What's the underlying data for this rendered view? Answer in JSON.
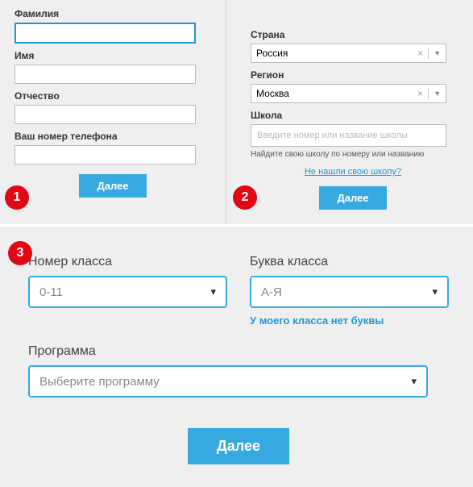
{
  "panel1": {
    "lastname_label": "Фамилия",
    "firstname_label": "Имя",
    "patronymic_label": "Отчество",
    "phone_label": "Ваш номер телефона",
    "next_btn": "Далее"
  },
  "panel2": {
    "country_label": "Страна",
    "country_value": "Россия",
    "region_label": "Регион",
    "region_value": "Москва",
    "school_label": "Школа",
    "school_placeholder": "Введите номер или название школы",
    "school_hint": "Найдите свою школу по номеру или названию",
    "noschool_link": "Не нашли свою школу?",
    "next_btn": "Далее"
  },
  "panel3": {
    "classnum_label": "Номер класса",
    "classnum_value": "0-11",
    "classletter_label": "Буква класса",
    "classletter_value": "А-Я",
    "noletter_link": "У моего класса нет буквы",
    "program_label": "Программа",
    "program_value": "Выберите программу",
    "next_btn": "Далее"
  },
  "badges": {
    "n1": "1",
    "n2": "2",
    "n3": "3"
  }
}
